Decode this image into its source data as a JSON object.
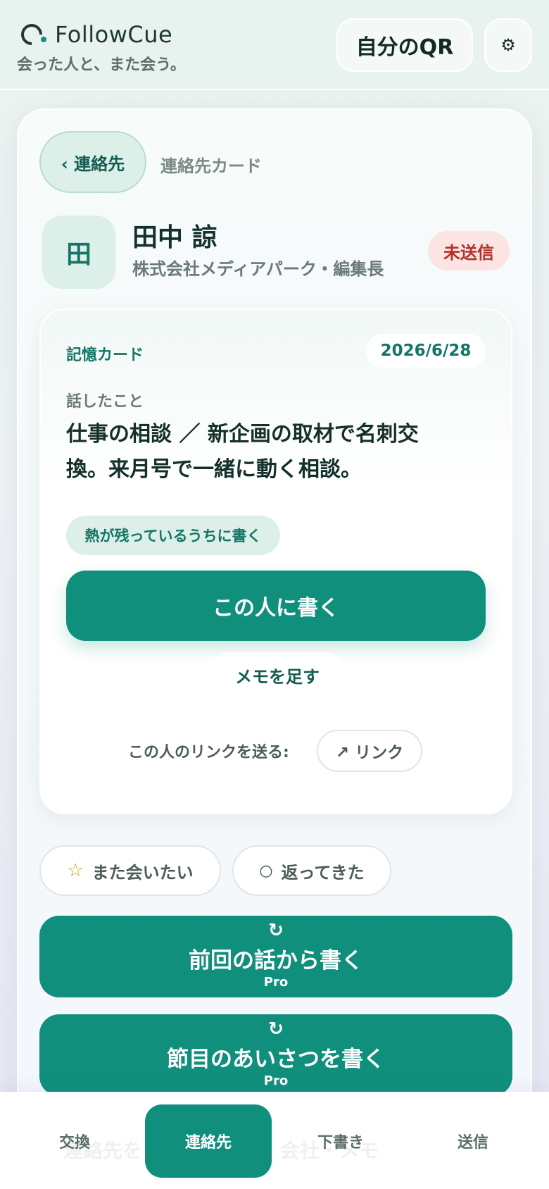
{
  "header": {
    "app_name": "FollowCue",
    "tagline": "会った人と、また会う。",
    "qr_button": "自分のQR",
    "settings_icon": "gear-icon",
    "settings_glyph": "⚙"
  },
  "nav_top": {
    "back_label": "‹ 連絡先",
    "breadcrumb": "連絡先カード"
  },
  "contact": {
    "avatar_initial": "田",
    "name": "田中 諒",
    "company": "株式会社メディアパーク・編集長",
    "status": "未送信"
  },
  "memory_card": {
    "label": "記憶カード",
    "date": "2026/6/28",
    "talk_label": "話したこと",
    "talk_text": "仕事の相談 ／ 新企画の取材で名刺交換。来月号で一緒に動く相談。",
    "hint": "熱が残っているうちに書く",
    "write_button": "この人に書く",
    "memo_button": "メモを足す",
    "link_label": "この人のリンクを送る:",
    "link_button": "↗ リンク"
  },
  "toggles": [
    {
      "icon": "star-icon",
      "glyph": "☆",
      "label": "また会いたい"
    },
    {
      "icon": "circle-icon",
      "glyph": "○",
      "label": "返ってきた"
    }
  ],
  "pro_actions": [
    {
      "icon": "refresh-icon",
      "glyph": "↻",
      "label": "前回の話から書く",
      "badge": "Pro"
    },
    {
      "icon": "refresh-icon",
      "glyph": "↻",
      "label": "節目のあいさつを書く",
      "badge": "Pro"
    }
  ],
  "bottom_nav": {
    "items": [
      "交換",
      "連絡先",
      "下書き",
      "送信"
    ],
    "active_index": 1,
    "ghost_text": "連絡先を　　　　　　　会社・メモ"
  },
  "colors": {
    "accent": "#108f7d",
    "danger": "#b3302b",
    "star": "#d4a21a"
  }
}
